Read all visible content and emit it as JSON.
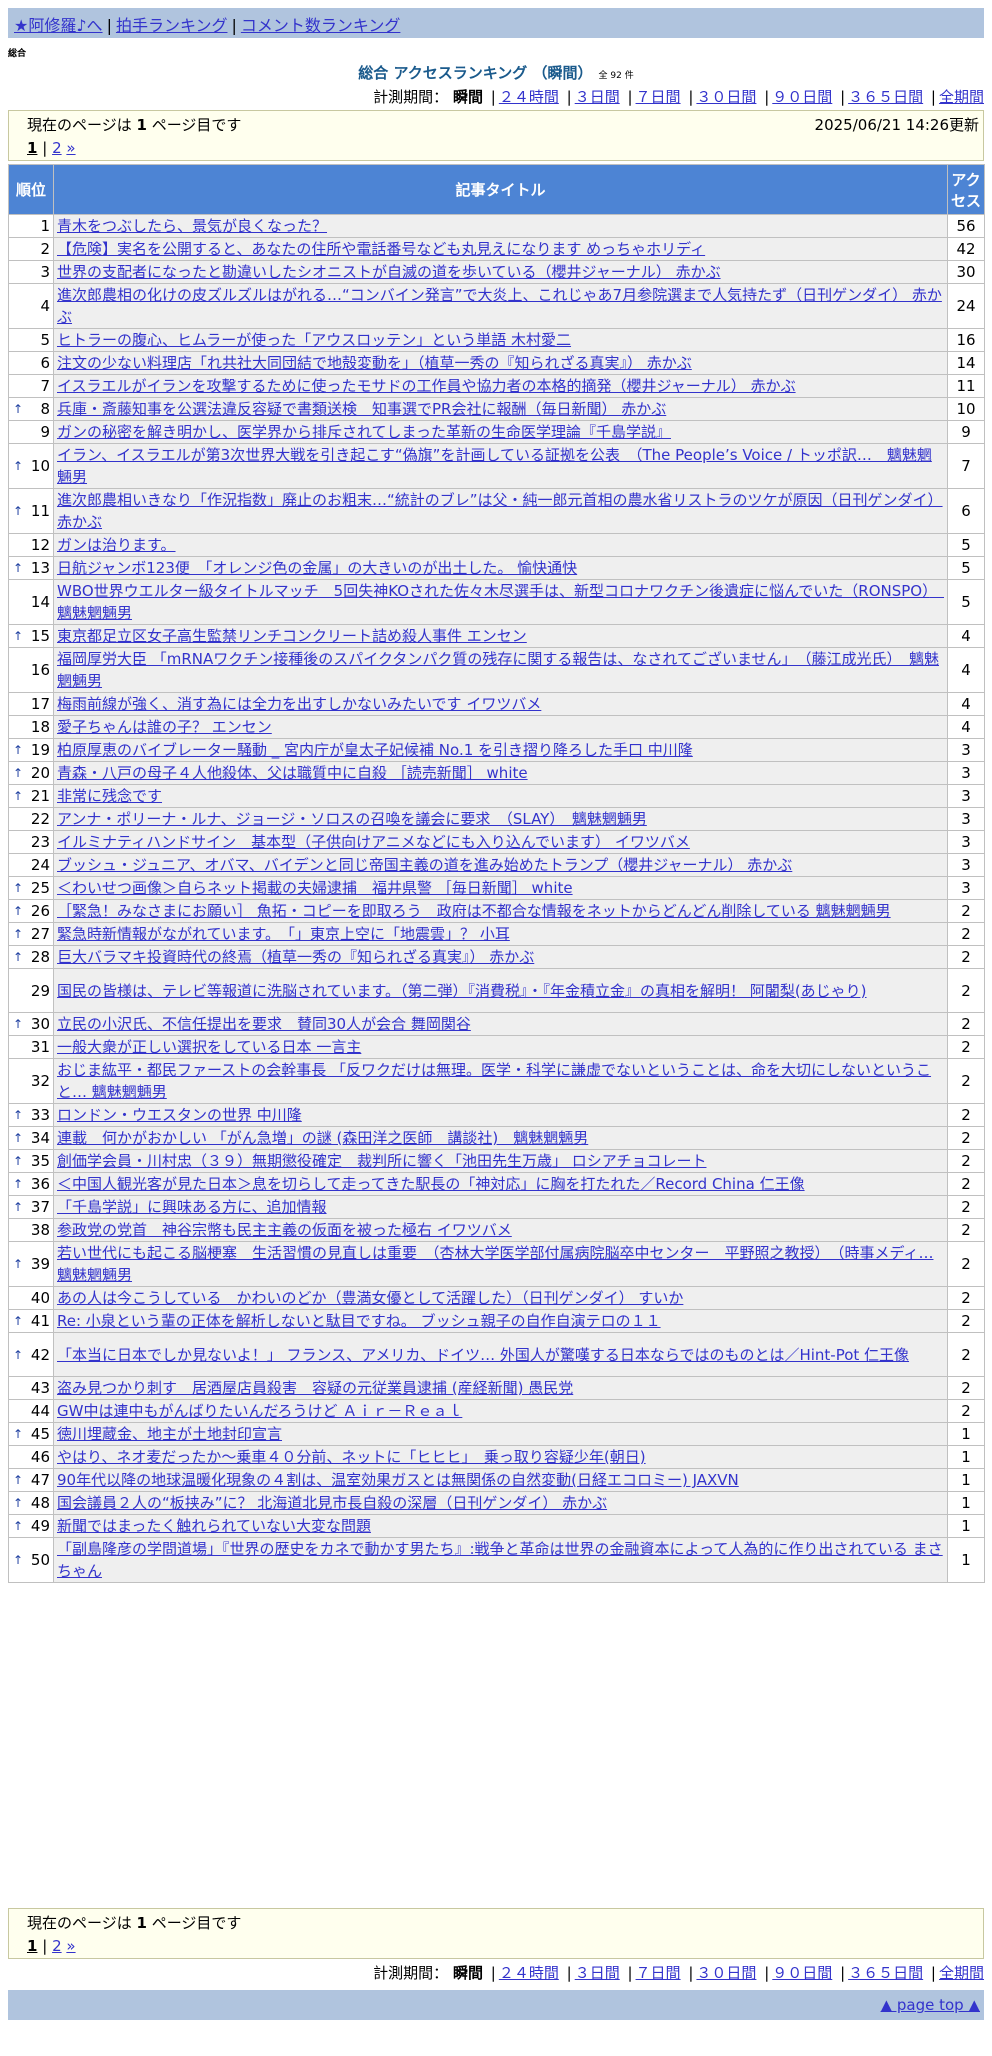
{
  "nav": {
    "home": "★阿修羅♪へ",
    "sep": "|",
    "clap_ranking": "拍手ランキング",
    "comment_ranking": "コメント数ランキング"
  },
  "breadcrumb": "総合",
  "title": "総合 アクセスランキング （瞬間）",
  "count": "全 92 件",
  "period": {
    "label": "計測期間：",
    "current": "瞬間",
    "options": [
      "２４時間",
      "３日間",
      "７日間",
      "３０日間",
      "９０日間",
      "３６５日間",
      "全期間"
    ]
  },
  "pager": {
    "current_text": "現在のページは 1 ページ目です",
    "current_prefix": "現在のページは",
    "current_num": "1",
    "current_suffix": "ページ目です",
    "updated": "2025/06/21 14:26更新",
    "page1": "1",
    "page2": "2",
    "next": "»",
    "sep": "|"
  },
  "table": {
    "col_rank": "順位",
    "col_title": "記事タイトル",
    "col_access": "アクセス",
    "up_icon": "↑",
    "rows": [
      {
        "rank": "1",
        "up": false,
        "title": "青木をつぶしたら、景気が良くなった？",
        "access": "56"
      },
      {
        "rank": "2",
        "up": false,
        "title": "【危険】実名を公開すると、あなたの住所や電話番号なども丸見えになります めっちゃホリディ",
        "access": "42"
      },
      {
        "rank": "3",
        "up": false,
        "title": "世界の支配者になったと勘違いしたシオニストが自滅の道を歩いている（櫻井ジャーナル） 赤かぶ",
        "access": "30"
      },
      {
        "rank": "4",
        "up": false,
        "title": "進次郎農相の化けの皮ズルズルはがれる…“コンバイン発言”で大炎上、これじゃあ7月参院選まで人気持たず（日刊ゲンダイ） 赤かぶ",
        "access": "24"
      },
      {
        "rank": "5",
        "up": false,
        "title": "ヒトラーの腹心、ヒムラーが使った「アウスロッテン」という単語 木村愛二",
        "access": "16"
      },
      {
        "rank": "6",
        "up": false,
        "title": "注文の少ない料理店「れ共社大同団結で地殻変動を」（植草一秀の『知られざる真実』） 赤かぶ",
        "access": "14"
      },
      {
        "rank": "7",
        "up": false,
        "title": "イスラエルがイランを攻撃するために使ったモサドの工作員や協力者の本格的摘発（櫻井ジャーナル） 赤かぶ",
        "access": "11"
      },
      {
        "rank": "8",
        "up": true,
        "title": "兵庫・斎藤知事を公選法違反容疑で書類送検　知事選でPR会社に報酬（毎日新聞） 赤かぶ",
        "access": "10"
      },
      {
        "rank": "9",
        "up": false,
        "title": "ガンの秘密を解き明かし、医学界から排斥されてしまった革新の生命医学理論『千島学説』",
        "access": "9"
      },
      {
        "rank": "10",
        "up": true,
        "title": "イラン、イスラエルが第3次世界大戦を引き起こす“偽旗”を計画している証拠を公表　（The People’s Voice / トッポ訳…　魑魅魍魎男",
        "access": "7"
      },
      {
        "rank": "11",
        "up": true,
        "title": "進次郎農相いきなり「作況指数」廃止のお粗末…“統計のブレ”は父・純一郎元首相の農水省リストラのツケが原因（日刊ゲンダイ） 赤かぶ",
        "access": "6"
      },
      {
        "rank": "12",
        "up": false,
        "title": "ガンは治ります。",
        "access": "5"
      },
      {
        "rank": "13",
        "up": true,
        "title": "日航ジャンボ123便　「オレンジ色の金属」の大きいのが出土した。 愉快通快",
        "access": "5"
      },
      {
        "rank": "14",
        "up": false,
        "title": "WBO世界ウエルター級タイトルマッチ　5回失神KOされた佐々木尽選手は、新型コロナワクチン後遺症に悩んでいた（RONSPO）　魑魅魍魎男",
        "access": "5"
      },
      {
        "rank": "15",
        "up": true,
        "title": "東京都足立区女子高生監禁リンチコンクリート詰め殺人事件 エンセン",
        "access": "4"
      },
      {
        "rank": "16",
        "up": false,
        "title": "福岡厚労大臣 「mRNAワクチン接種後のスパイクタンパク質の残存に関する報告は、なされてございません」　（藤江成光氏）　魑魅魍魎男",
        "access": "4"
      },
      {
        "rank": "17",
        "up": false,
        "title": "梅雨前線が強く、消す為には全力を出すしかないみたいです イワツバメ",
        "access": "4"
      },
      {
        "rank": "18",
        "up": false,
        "title": "愛子ちゃんは誰の子？ エンセン",
        "access": "4"
      },
      {
        "rank": "19",
        "up": true,
        "title": "柏原厚恵のバイブレーター騒動 _ 宮内庁が皇太子妃候補 No.1 を引き摺り降ろした手口 中川隆",
        "access": "3"
      },
      {
        "rank": "20",
        "up": true,
        "title": "青森・八戸の母子４人他殺体、父は職質中に自殺 ［読売新聞］ white",
        "access": "3"
      },
      {
        "rank": "21",
        "up": true,
        "title": "非常に残念です",
        "access": "3"
      },
      {
        "rank": "22",
        "up": false,
        "title": "アンナ・ポリーナ・ルナ、ジョージ・ソロスの召喚を議会に要求　（SLAY）　魑魅魍魎男",
        "access": "3"
      },
      {
        "rank": "23",
        "up": false,
        "title": "イルミナティハンドサイン　基本型（子供向けアニメなどにも入り込んでいます） イワツバメ",
        "access": "3"
      },
      {
        "rank": "24",
        "up": false,
        "title": "ブッシュ・ジュニア、オバマ、バイデンと同じ帝国主義の道を進み始めたトランプ（櫻井ジャーナル） 赤かぶ",
        "access": "3"
      },
      {
        "rank": "25",
        "up": true,
        "title": "＜わいせつ画像＞自らネット掲載の夫婦逮捕　福井県警 ［毎日新聞］ white",
        "access": "3"
      },
      {
        "rank": "26",
        "up": true,
        "title": "［緊急！みなさまにお願い］ 魚拓・コピーを即取ろう　政府は不都合な情報をネットからどんどん削除している 魑魅魍魎男",
        "access": "2"
      },
      {
        "rank": "27",
        "up": true,
        "title": "緊急時新情報がながれています。　「」東京上空に「地震雲」？ 小耳",
        "access": "2"
      },
      {
        "rank": "28",
        "up": true,
        "title": "巨大バラマキ投資時代の終焉（植草一秀の『知られざる真実』） 赤かぶ",
        "access": "2"
      },
      {
        "rank": "29",
        "up": false,
        "title": "国民の皆様は、テレビ等報道に洗脳されています。（第二弾）『消費税』・『年金積立金』の真相を解明！ 阿闍梨(あじゃり)",
        "access": "2"
      },
      {
        "rank": "30",
        "up": true,
        "title": "立民の小沢氏、不信任提出を要求　賛同30人が会合 舞岡関谷",
        "access": "2"
      },
      {
        "rank": "31",
        "up": false,
        "title": "一般大衆が正しい選択をしている日本 一言主",
        "access": "2"
      },
      {
        "rank": "32",
        "up": false,
        "title": "おじま紘平・都民ファーストの会幹事長 「反ワクだけは無理。医学・科学に謙虚でないということは、命を大切にしないということ… 魑魅魍魎男",
        "access": "2"
      },
      {
        "rank": "33",
        "up": true,
        "title": "ロンドン・ウエスタンの世界 中川隆",
        "access": "2"
      },
      {
        "rank": "34",
        "up": true,
        "title": "連載　何かがおかしい 「がん急増」の謎 (森田洋之医師　講談社)　魑魅魍魎男",
        "access": "2"
      },
      {
        "rank": "35",
        "up": true,
        "title": "創価学会員・川村忠（３９）無期懲役確定　裁判所に響く「池田先生万歳」 ロシアチョコレート",
        "access": "2"
      },
      {
        "rank": "36",
        "up": true,
        "title": "＜中国人観光客が見た日本＞息を切らして走ってきた駅長の「神対応」に胸を打たれた／Record China 仁王像",
        "access": "2"
      },
      {
        "rank": "37",
        "up": true,
        "title": "「千島学説」に興味ある方に、追加情報",
        "access": "2"
      },
      {
        "rank": "38",
        "up": false,
        "title": "参政党の党首　神谷宗幣も民主主義の仮面を被った極右 イワツバメ",
        "access": "2"
      },
      {
        "rank": "39",
        "up": true,
        "title": "若い世代にも起こる脳梗塞　生活習慣の見直しは重要　（杏林大学医学部付属病院脳卒中センター　平野照之教授）　（時事メディ… 魑魅魍魎男",
        "access": "2"
      },
      {
        "rank": "40",
        "up": false,
        "title": "あの人は今こうしている　かわいのどか（豊満女優として活躍した）（日刊ゲンダイ） すいか",
        "access": "2"
      },
      {
        "rank": "41",
        "up": true,
        "title": "Re: 小泉という輩の正体を解析しないと駄目ですね。 ブッシュ親子の自作自演テロの１１",
        "access": "2"
      },
      {
        "rank": "42",
        "up": true,
        "title": "「本当に日本でしか見ないよ！」 フランス、アメリカ、ドイツ… 外国人が驚嘆する日本ならではのものとは／Hint-Pot 仁王像",
        "access": "2"
      },
      {
        "rank": "43",
        "up": false,
        "title": "盗み見つかり刺す　居酒屋店員殺害　容疑の元従業員逮捕 (産経新聞) 愚民党",
        "access": "2"
      },
      {
        "rank": "44",
        "up": false,
        "title": "GW中は連中もがんばりたいんだろうけど Ａｉｒ－Ｒｅａｌ",
        "access": "2"
      },
      {
        "rank": "45",
        "up": true,
        "title": "徳川埋蔵金、地主が土地封印宣言",
        "access": "1"
      },
      {
        "rank": "46",
        "up": false,
        "title": "やはり、ネオ麦だったか～乗車４０分前、ネットに「ヒヒヒ」　乗っ取り容疑少年(朝日)",
        "access": "1"
      },
      {
        "rank": "47",
        "up": true,
        "title": "90年代以降の地球温暖化現象の４割は、温室効果ガスとは無関係の自然変動(日経エコロミー) JAXVN",
        "access": "1"
      },
      {
        "rank": "48",
        "up": true,
        "title": "国会議員２人の“板挟み”に？ 北海道北見市長自殺の深層（日刊ゲンダイ） 赤かぶ",
        "access": "1"
      },
      {
        "rank": "49",
        "up": true,
        "title": "新聞ではまったく触れられていない大変な問題",
        "access": "1"
      },
      {
        "rank": "50",
        "up": true,
        "title": "「副島隆彦の学問道場」『世界の歴史をカネで動かす男たち』:戦争と革命は世界の金融資本によって人為的に作り出されている まさちゃん",
        "access": "1"
      }
    ]
  },
  "footer": {
    "page_top": "▲ page top ▲"
  },
  "colors": {
    "nav_bg": "#b0c4de",
    "header_bg": "#4d84d4",
    "title_color": "#1a5a8c",
    "link": "#3333cc",
    "pager_bg": "#ffffee"
  }
}
